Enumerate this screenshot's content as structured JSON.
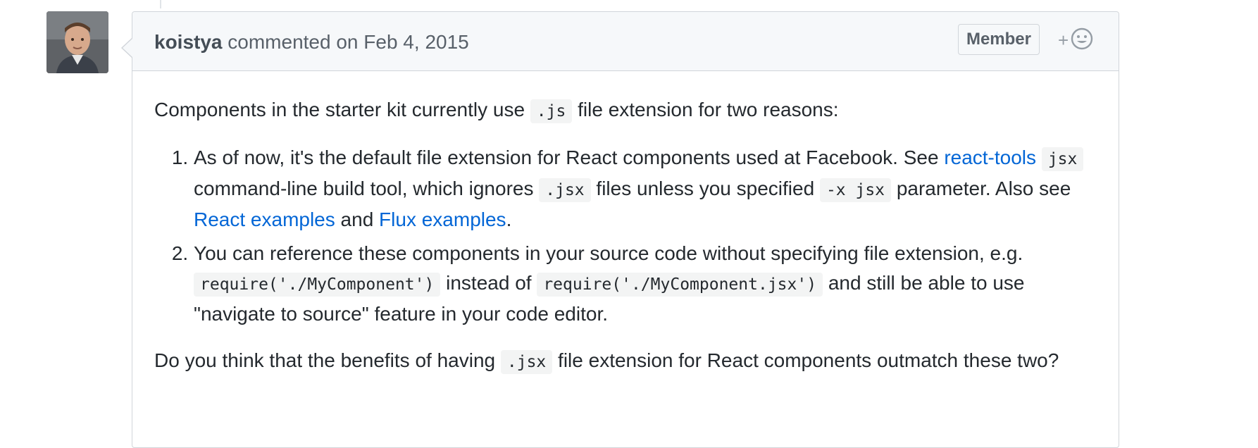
{
  "comment": {
    "author": "koistya",
    "action": "commented on",
    "date": "Feb 4, 2015",
    "badge": "Member",
    "reaction_icon": "smiley-icon",
    "reaction_plus": "+",
    "avatar_alt": "koistya avatar"
  },
  "body": {
    "intro_before": "Components in the starter kit currently use",
    "intro_code": ".js",
    "intro_after": "file extension for two reasons:",
    "item1": {
      "text_a": "As of now, it's the default file extension for React components used at Facebook. See",
      "link_react_tools": "react-tools",
      "code_jsx": "jsx",
      "text_b": "command-line build tool, which ignores",
      "code_dot_jsx": ".jsx",
      "text_c": "files unless you specified",
      "code_x_jsx": "-x jsx",
      "text_d": "parameter. Also see",
      "link_react_examples": "React examples",
      "text_e": "and",
      "link_flux_examples": "Flux examples",
      "text_f": "."
    },
    "item2": {
      "text_a": "You can reference these components in your source code without specifying file extension, e.g.",
      "code_require_a": "require('./MyComponent')",
      "text_b": "instead of",
      "code_require_b": "require('./MyComponent.jsx')",
      "text_c": "and still be able to use \"navigate to source\" feature in your code editor."
    },
    "question_before": "Do you think that the benefits of having",
    "question_code": ".jsx",
    "question_after": "file extension for React components outmatch these two?"
  },
  "colors": {
    "link": "#0366d6",
    "header_bg": "#f6f8fa",
    "border": "#d1d5da"
  }
}
